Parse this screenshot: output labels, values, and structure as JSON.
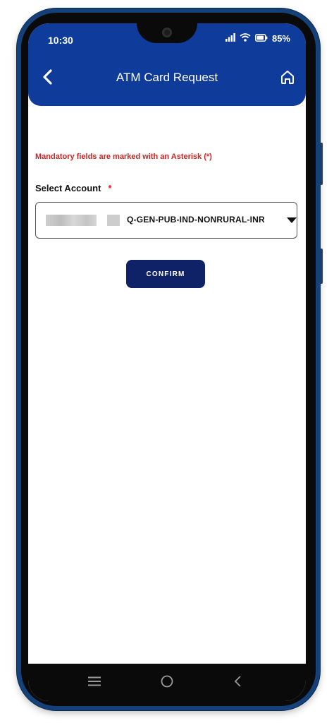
{
  "status_bar": {
    "time": "10:30",
    "battery": "85%"
  },
  "header": {
    "title": "ATM Card Request",
    "back_icon": "chevron-left-icon",
    "home_icon": "home-icon"
  },
  "form": {
    "mandatory_note": "Mandatory fields are marked with an Asterisk (*)",
    "select_account_label": "Select Account",
    "required_marker": "*",
    "account_value": "Q-GEN-PUB-IND-NONRURAL-INR",
    "confirm_label": "CONFIRM"
  },
  "nav_bar": {
    "icons": [
      "menu-icon",
      "home-circle-icon",
      "back-icon"
    ]
  },
  "colors": {
    "header_blue": "#0f3b9a",
    "button_navy": "#0f2167",
    "error_red": "#d41f1f",
    "phone_frame": "#14417a"
  }
}
